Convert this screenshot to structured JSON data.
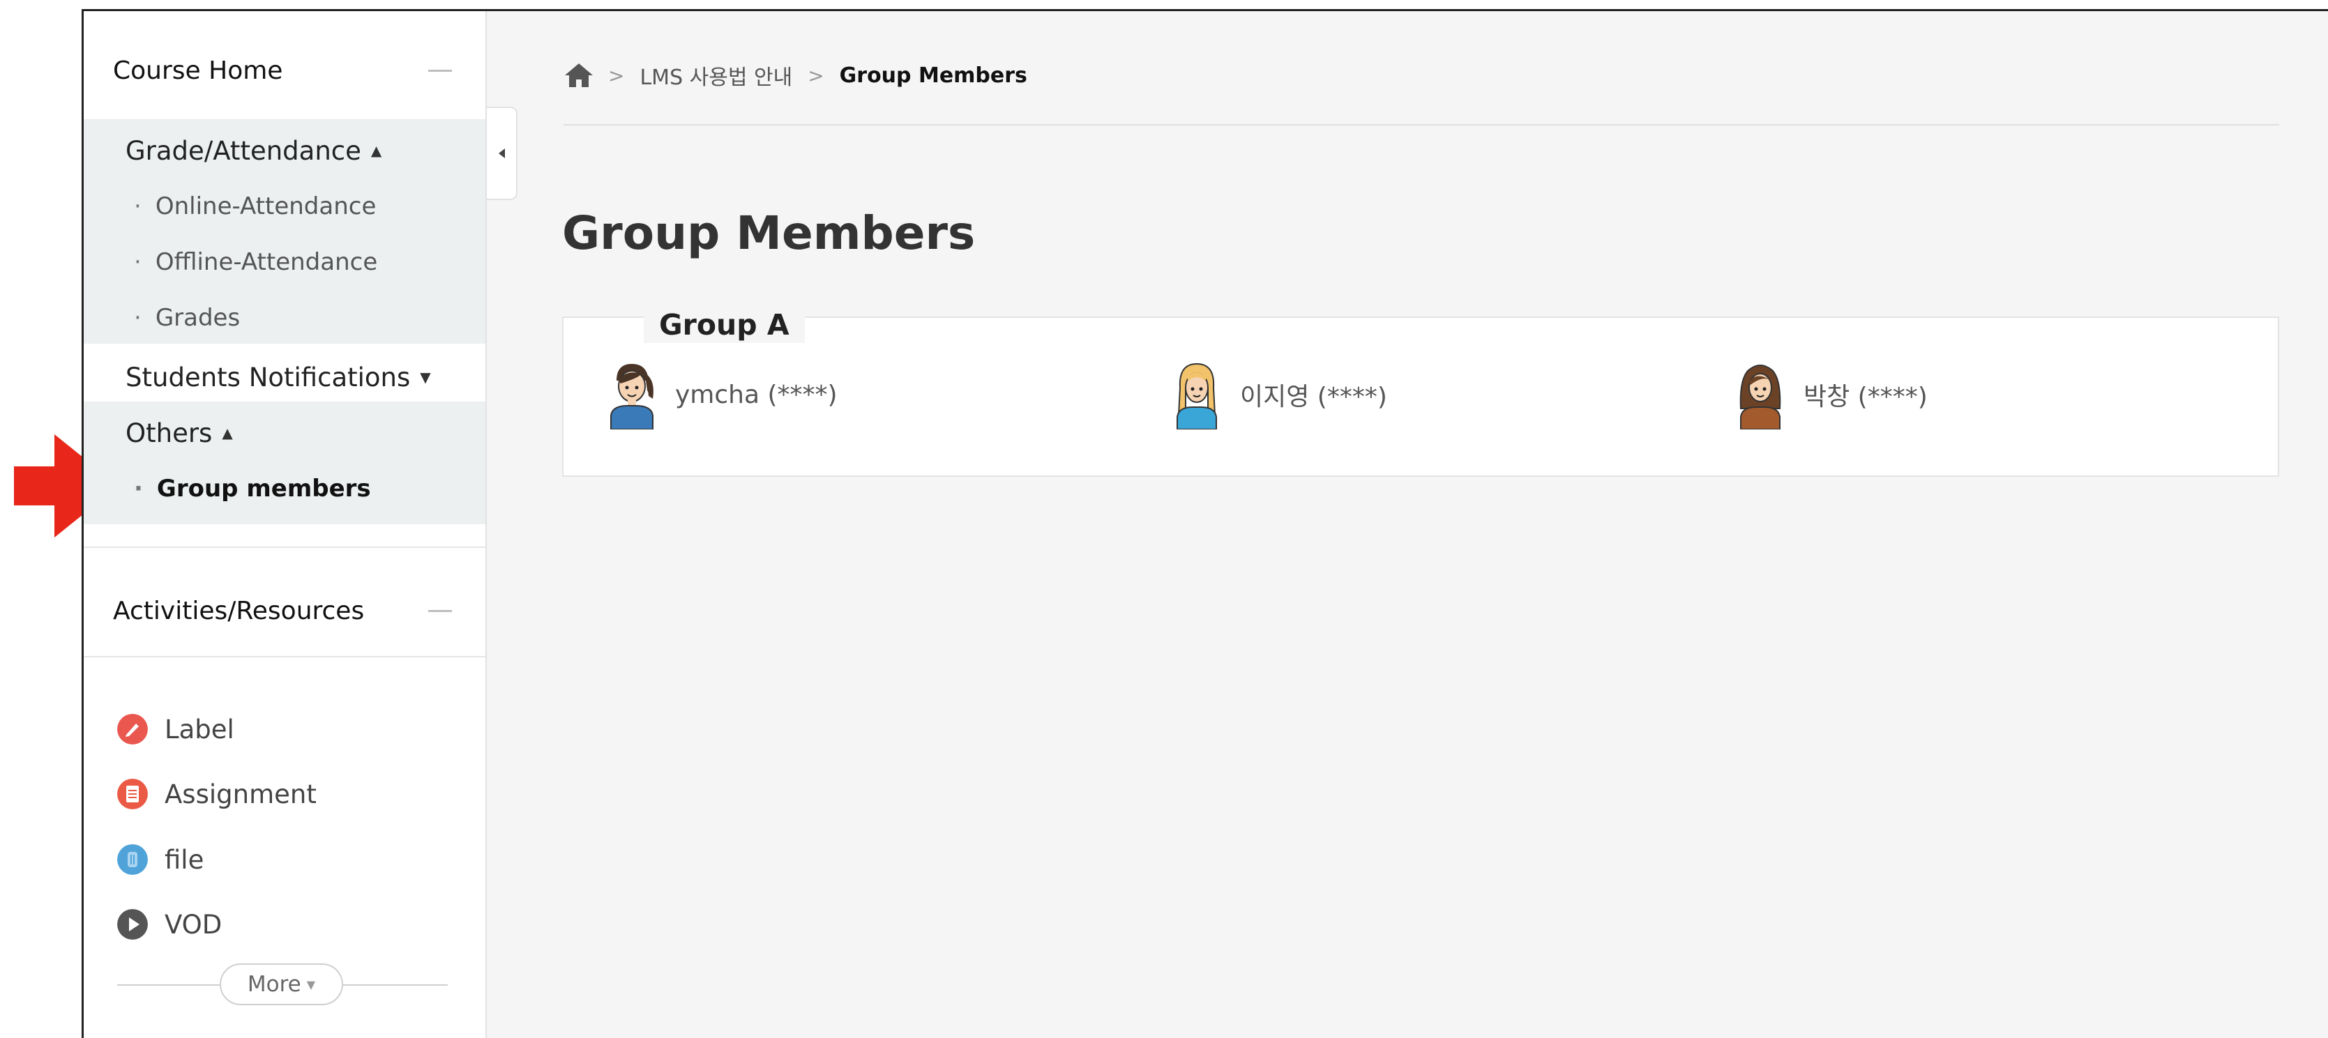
{
  "sidebar": {
    "course_home": "Course Home",
    "grade_attendance": "Grade/Attendance",
    "online_attendance": "Online-Attendance",
    "offline_attendance": "Offline-Attendance",
    "grades": "Grades",
    "students_notifications": "Students Notifications",
    "others": "Others",
    "group_members": "Group members",
    "activities_resources": "Activities/Resources",
    "activities": [
      {
        "label": "Label",
        "icon": "label-icon",
        "color": "#e9574f"
      },
      {
        "label": "Assignment",
        "icon": "assignment-icon",
        "color": "#ea5a45"
      },
      {
        "label": "file",
        "icon": "file-icon",
        "color": "#4fa3d9"
      },
      {
        "label": "VOD",
        "icon": "vod-icon",
        "color": "#555555"
      }
    ],
    "more": "More"
  },
  "breadcrumb": {
    "course": "LMS 사용법 안내",
    "current": "Group Members"
  },
  "main": {
    "title": "Group Members",
    "group_name": "Group A",
    "members": [
      {
        "name": "ymcha (****)",
        "avatar": "girl-ponytail-avatar"
      },
      {
        "name": "이지영 (****)",
        "avatar": "girl-blonde-avatar"
      },
      {
        "name": "박창 (****)",
        "avatar": "girl-brown-hair-avatar"
      }
    ]
  },
  "colors": {
    "accent_arrow": "#e8261a"
  }
}
